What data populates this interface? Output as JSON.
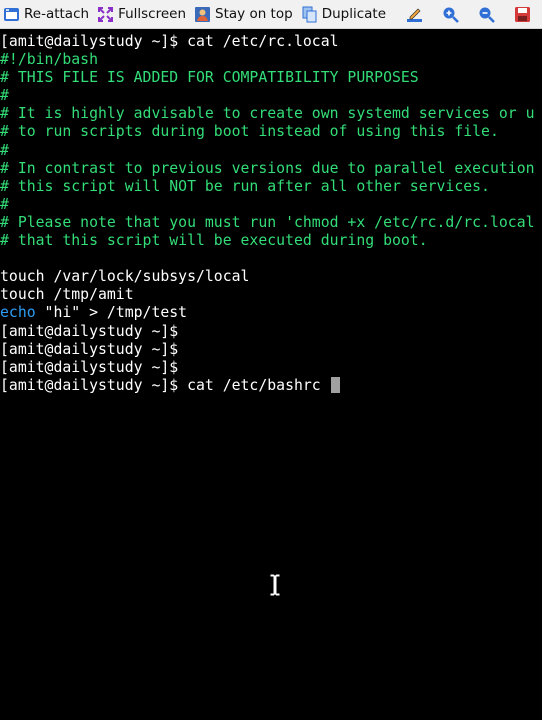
{
  "toolbar": {
    "reattach_label": "Re-attach",
    "fullscreen_label": "Fullscreen",
    "stay_on_top_label": "Stay on top",
    "duplicate_label": "Duplicate",
    "icons": [
      "reattach-icon",
      "fullscreen-icon",
      "stay-on-top-icon",
      "duplicate-icon",
      "edit-icon",
      "zoom-in-icon",
      "zoom-out-icon",
      "save-icon",
      "more-icon"
    ]
  },
  "terminal": {
    "colors": {
      "background": "#000000",
      "text": "#ffffff",
      "comment": "#33dd77",
      "keyword": "#2e9cf5"
    },
    "lines": [
      "[amit@dailystudy ~]$ cat /etc/rc.local",
      "#!/bin/bash",
      "# THIS FILE IS ADDED FOR COMPATIBILITY PURPOSES",
      "#",
      "# It is highly advisable to create own systemd services or u",
      "# to run scripts during boot instead of using this file.",
      "#",
      "# In contrast to previous versions due to parallel execution",
      "# this script will NOT be run after all other services.",
      "#",
      "# Please note that you must run 'chmod +x /etc/rc.d/rc.local",
      "# that this script will be executed during boot.",
      "",
      "touch /var/lock/subsys/local",
      "touch /tmp/amit",
      "echo",
      " \"hi\" > /tmp/test",
      "[amit@dailystudy ~]$",
      "[amit@dailystudy ~]$",
      "[amit@dailystudy ~]$",
      "[amit@dailystudy ~]$ cat /etc/bashrc "
    ]
  }
}
